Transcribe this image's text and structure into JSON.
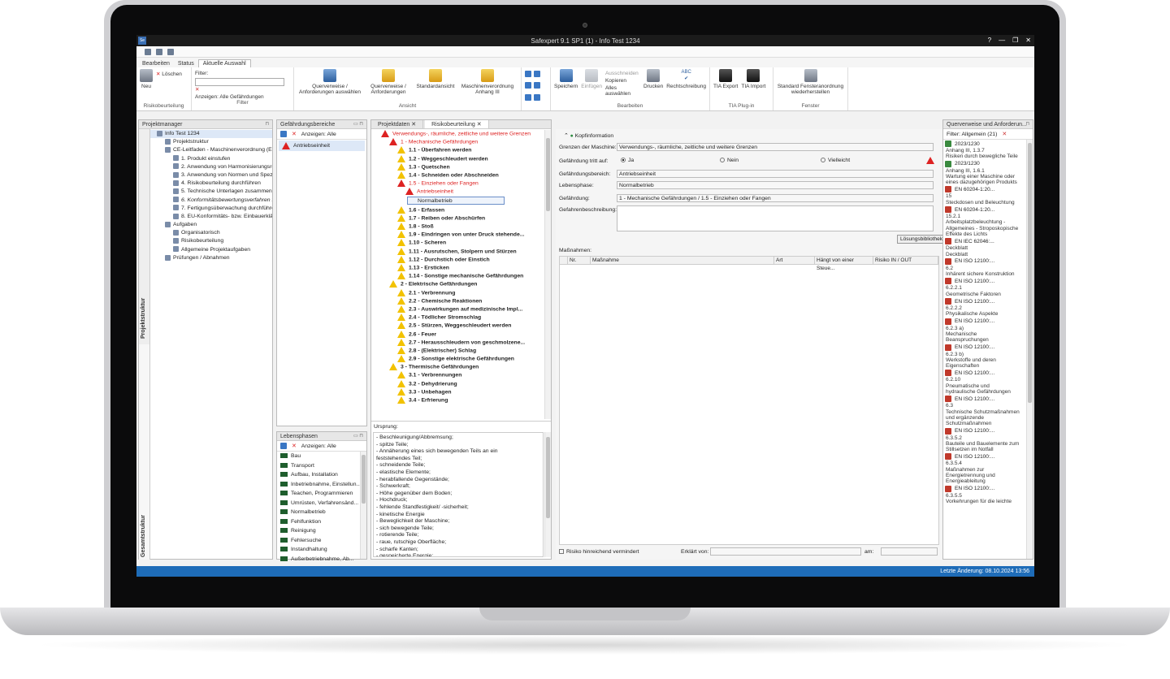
{
  "window": {
    "title": "Safexpert 9.1 SP1 (1)  -  Info Test 1234",
    "logo": "Se",
    "help": "?",
    "minimize": "—",
    "restore": "❐",
    "close": "✕"
  },
  "ribbon_tabs": [
    "Bearbeiten",
    "Status",
    "Aktuelle Auswahl"
  ],
  "ribbon": {
    "neu": "Neu",
    "loeschen": "Löschen",
    "risk_group": "Risikobeurteilung",
    "filter_label": "Filter:",
    "anzeigen_label": "Anzeigen: Alle Gefährdungen",
    "filter_group": "Filter",
    "quer1": "Querverweise / Anforderungen auswählen",
    "quer2": "Querverweise / Anforderungen",
    "standard": "Standardansicht",
    "maschinen": "Maschinenverordnung Anhang III",
    "ansicht_group": "Ansicht",
    "speichern": "Speichern",
    "einfuegen": "Einfügen",
    "ausschneiden": "Ausschneiden",
    "kopieren": "Kopieren",
    "alles": "Alles auswählen",
    "drucken": "Drucken",
    "rechtschreibung": "Rechtschreibung",
    "abc": "ABC",
    "bearbeiten_group": "Bearbeiten",
    "tia_export": "TIA Export",
    "tia_import": "TIA Import",
    "tia_group": "TIA Plug-in",
    "fenster": "Standard Fensteranordnung wiederherstellen",
    "fenster_group": "Fenster"
  },
  "projektmanager": {
    "title": "Projektmanager",
    "items": [
      {
        "label": "Info Test 1234",
        "level": 0,
        "selected": true
      },
      {
        "label": "Projektstruktur",
        "level": 1
      },
      {
        "label": "CE-Leitfaden - Maschinenverordnung (E...",
        "level": 1
      },
      {
        "label": "1. Produkt einstufen",
        "level": 2
      },
      {
        "label": "2. Anwendung von Harmonisierungsrec...",
        "level": 2
      },
      {
        "label": "3. Anwendung von Normen und Spezifi...",
        "level": 2
      },
      {
        "label": "4. Risikobeurteilung durchführen",
        "level": 2
      },
      {
        "label": "5. Technische Unterlagen zusammenste...",
        "level": 2
      },
      {
        "label": "6. Konformitätsbewertungsverfahren f...",
        "level": 2,
        "italic": true
      },
      {
        "label": "7. Fertigungsüberwachung durchführen",
        "level": 2
      },
      {
        "label": "8. EU-Konformitäts- bzw. Einbauerkläru...",
        "level": 2
      },
      {
        "label": "Aufgaben",
        "level": 1
      },
      {
        "label": "Organisatorisch",
        "level": 2
      },
      {
        "label": "Risikobeurteilung",
        "level": 2
      },
      {
        "label": "Allgemeine Projektaufgaben",
        "level": 2
      },
      {
        "label": "Prüfungen / Abnahmen",
        "level": 1
      }
    ],
    "vtab_top": "Projektstruktur",
    "vtab_bottom": "Gesamtstruktur"
  },
  "gefahrbereiche": {
    "title": "Gefährdungsbereiche",
    "anzeigen": "Anzeigen: Alle",
    "items": [
      "Antriebseinheit"
    ]
  },
  "lebensphasen": {
    "title": "Lebensphasen",
    "anzeigen": "Anzeigen: Alle",
    "items": [
      "Bau",
      "Transport",
      "Aufbau, Installation",
      "Inbetriebnahme, Einstellun...",
      "Teachen, Programmieren",
      "Umrüsten, Verfahrensänd...",
      "Normalbetrieb",
      "Fehlfunktion",
      "Reinigung",
      "Fehlersuche",
      "Instandhaltung",
      "Außerbetriebnahme, Ab..."
    ]
  },
  "center_tabs": [
    "Projektdaten",
    "Risikobeurteilung"
  ],
  "hazard_tree": [
    {
      "label": "Verwendungs-, räumliche, zeitliche und weitere Grenzen",
      "level": 0,
      "red": true,
      "icon": "red"
    },
    {
      "label": "1 - Mechanische Gefährdungen",
      "level": 1,
      "red": true,
      "icon": "red"
    },
    {
      "label": "1.1 - Überfahren werden",
      "level": 2,
      "bold": true
    },
    {
      "label": "1.2 - Weggeschleudert werden",
      "level": 2,
      "bold": true
    },
    {
      "label": "1.3 - Quetschen",
      "level": 2,
      "bold": true
    },
    {
      "label": "1.4 - Schneiden oder Abschneiden",
      "level": 2,
      "bold": true
    },
    {
      "label": "1.5 - Einziehen oder Fangen",
      "level": 2,
      "red": true,
      "icon": "red"
    },
    {
      "label": "Antriebseinheit",
      "level": 3,
      "red": true,
      "icon": "red"
    },
    {
      "label": "Normalbetrieb",
      "level": 4,
      "select": true
    },
    {
      "label": "1.6 - Erfassen",
      "level": 2,
      "bold": true
    },
    {
      "label": "1.7 - Reiben oder Abschürfen",
      "level": 2,
      "bold": true
    },
    {
      "label": "1.8 - Stoß",
      "level": 2,
      "bold": true
    },
    {
      "label": "1.9 - Eindringen von unter Druck stehende...",
      "level": 2,
      "bold": true
    },
    {
      "label": "1.10 - Scheren",
      "level": 2,
      "bold": true
    },
    {
      "label": "1.11 - Ausrutschen, Stolpern und Stürzen",
      "level": 2,
      "bold": true
    },
    {
      "label": "1.12 - Durchstich oder Einstich",
      "level": 2,
      "bold": true
    },
    {
      "label": "1.13 - Ersticken",
      "level": 2,
      "bold": true
    },
    {
      "label": "1.14 - Sonstige mechanische Gefährdungen",
      "level": 2,
      "bold": true
    },
    {
      "label": "2 - Elektrische Gefährdungen",
      "level": 1,
      "bold": true
    },
    {
      "label": "2.1 - Verbrennung",
      "level": 2,
      "bold": true
    },
    {
      "label": "2.2 - Chemische Reaktionen",
      "level": 2,
      "bold": true
    },
    {
      "label": "2.3 - Auswirkungen auf medizinische Impl...",
      "level": 2,
      "bold": true
    },
    {
      "label": "2.4 - Tödlicher Stromschlag",
      "level": 2,
      "bold": true
    },
    {
      "label": "2.5 - Stürzen, Weggeschleudert werden",
      "level": 2,
      "bold": true
    },
    {
      "label": "2.6 - Feuer",
      "level": 2,
      "bold": true
    },
    {
      "label": "2.7 - Herausschleudern von geschmolzene...",
      "level": 2,
      "bold": true
    },
    {
      "label": "2.8 - (Elektrischer) Schlag",
      "level": 2,
      "bold": true
    },
    {
      "label": "2.9 - Sonstige elektrische Gefährdungen",
      "level": 2,
      "bold": true
    },
    {
      "label": "3 - Thermische Gefährdungen",
      "level": 1,
      "bold": true
    },
    {
      "label": "3.1 - Verbrennungen",
      "level": 2,
      "bold": true
    },
    {
      "label": "3.2 - Dehydrierung",
      "level": 2,
      "bold": true
    },
    {
      "label": "3.3 - Unbehagen",
      "level": 2,
      "bold": true
    },
    {
      "label": "3.4 - Erfrierung",
      "level": 2,
      "bold": true
    }
  ],
  "ursprung": {
    "label": "Ursprung:",
    "lines": [
      "- Beschleunigung/Abbremsung;",
      "- spitze Teile;",
      "- Annäherung eines sich bewegenden Teils an ein",
      "feststehendes Teil;",
      "- schneidende Teile;",
      "- elastische Elemente;",
      "- herabfallende Gegenstände;",
      "- Schwerkraft;",
      "- Höhe gegenüber dem Boden;",
      "- Hochdruck;",
      "- fehlende Standfestigkeit/ -sicherheit;",
      "- kinetische Energie",
      "- Beweglichkeit der Maschine;",
      "- sich bewegende Teile;",
      "- rotierende Teile;",
      "- raue, rutschige Oberfläche;",
      "- scharfe Kanten;",
      "- gespeicherte Energie;"
    ]
  },
  "form": {
    "kopf": "Kopfinformation",
    "grenzen_label": "Grenzen der Maschine:",
    "grenzen_value": "Verwendungs-, räumliche, zeitliche und weitere Grenzen",
    "tritt_label": "Gefährdung tritt auf:",
    "ja": "Ja",
    "nein": "Nein",
    "vielleicht": "Vielleicht",
    "bereich_label": "Gefährdungsbereich:",
    "bereich_value": "Antriebseinheit",
    "phase_label": "Lebensphase:",
    "phase_value": "Normalbetrieb",
    "gef_label": "Gefährdung:",
    "gef_value": "1 - Mechanische Gefährdungen / 1.5 - Einziehen oder Fangen",
    "beschr_label": "Gefahrenbeschreibung:",
    "loesung": "Lösungsbibliothek",
    "massnahmen_label": "Maßnahmen:",
    "cols": [
      "Nr.",
      "Maßnahme",
      "Art",
      "Hängt von einer Steue...",
      "Risiko IN / OUT"
    ],
    "risiko_check": "Risiko hinreichend vermindert",
    "erklaert": "Erklärt von:",
    "am": "am:"
  },
  "right_panel": {
    "title": "Querverweise und Anforderun...",
    "filter": "Filter: Allgemein (21)",
    "entries": [
      {
        "code": "2023/1230",
        "lines": [
          "Anhang III, 1.3.7",
          "Risiken durch bewegliche Teile"
        ],
        "type": "eu"
      },
      {
        "code": "2023/1230",
        "lines": [
          "Anhang III, 1.6.1",
          "Wartung einer Maschine oder",
          "eines dazugehörigen Produkts"
        ],
        "type": "eu"
      },
      {
        "code": "EN 60204-1:20...",
        "lines": [
          "15",
          "Steckdosen und Beleuchtung"
        ],
        "type": "en"
      },
      {
        "code": "EN 60204-1:20...",
        "lines": [
          "15.2.1",
          "Arbeitsplatzbeleuchtung -",
          "Allgemeines - Stroposkopische",
          "Effekte des Lichts"
        ],
        "type": "en"
      },
      {
        "code": "EN IEC 62046:...",
        "lines": [
          "Deckblatt",
          "Deckblatt"
        ],
        "type": "en"
      },
      {
        "code": "EN ISO 12100:...",
        "lines": [
          "6.2",
          "Inhärent sichere Konstruktion"
        ],
        "type": "en"
      },
      {
        "code": "EN ISO 12100:...",
        "lines": [
          "6.2.2.1",
          "Geometrische Faktoren"
        ],
        "type": "en"
      },
      {
        "code": "EN ISO 12100:...",
        "lines": [
          "6.2.2.2",
          "Physikalische Aspekte"
        ],
        "type": "en"
      },
      {
        "code": "EN ISO 12100:...",
        "lines": [
          "6.2.3 a)",
          "Mechanische",
          "Beanspruchungen"
        ],
        "type": "en"
      },
      {
        "code": "EN ISO 12100:...",
        "lines": [
          "6.2.3 b)",
          "Werkstoffe und deren",
          "Eigenschaften"
        ],
        "type": "en"
      },
      {
        "code": "EN ISO 12100:...",
        "lines": [
          "6.2.10",
          "Pneumatische und",
          "hydraulische Gefährdungen"
        ],
        "type": "en"
      },
      {
        "code": "EN ISO 12100:...",
        "lines": [
          "6.3",
          "Technische Schutzmaßnahmen",
          "und ergänzende",
          "Schutzmaßnahmen"
        ],
        "type": "en"
      },
      {
        "code": "EN ISO 12100:...",
        "lines": [
          "6.3.5.2",
          "Bauteile und Bauelemente zum",
          "Stillsetzen im Notfall"
        ],
        "type": "en"
      },
      {
        "code": "EN ISO 12100:...",
        "lines": [
          "6.3.5.4",
          "Maßnahmen zur",
          "Energietrennung und",
          "Energieableitung"
        ],
        "type": "en"
      },
      {
        "code": "EN ISO 12100:...",
        "lines": [
          "6.3.5.5",
          "Vorkehrungen für die leichte"
        ],
        "type": "en"
      }
    ]
  },
  "status": {
    "text": "Letzte Änderung: 08.10.2024 13:56"
  },
  "colors": {
    "statusbar": "#1e6cb8",
    "accent_red": "#d22222",
    "warning": "#f2c200"
  }
}
